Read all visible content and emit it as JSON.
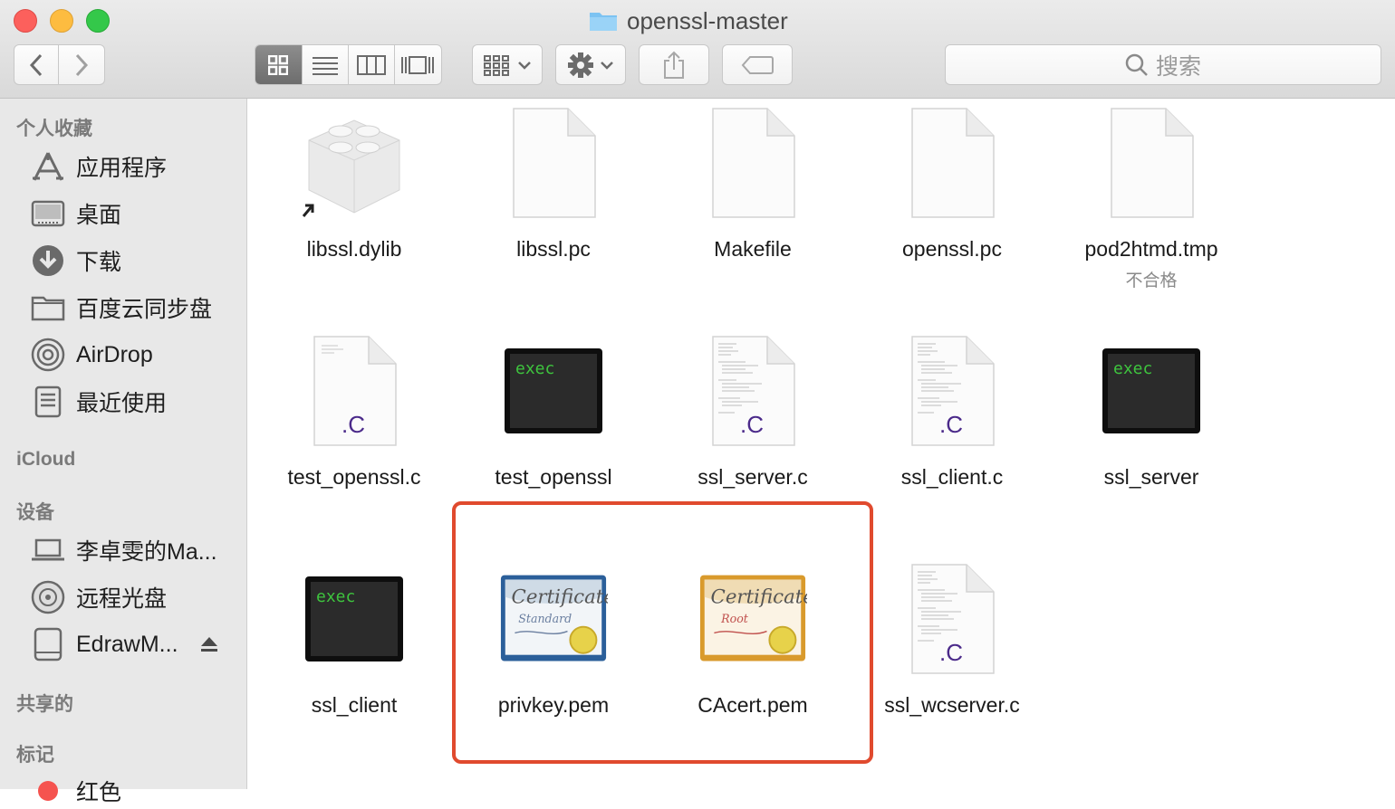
{
  "window": {
    "title": "openssl-master",
    "search_placeholder": "搜索"
  },
  "sidebar": {
    "sections": [
      {
        "heading": "个人收藏",
        "items": [
          {
            "label": "应用程序",
            "icon": "applications-icon"
          },
          {
            "label": "桌面",
            "icon": "desktop-icon"
          },
          {
            "label": "下载",
            "icon": "downloads-icon"
          },
          {
            "label": "百度云同步盘",
            "icon": "folder-icon"
          },
          {
            "label": "AirDrop",
            "icon": "airdrop-icon"
          },
          {
            "label": "最近使用",
            "icon": "recents-icon"
          }
        ]
      },
      {
        "heading": "iCloud",
        "items": []
      },
      {
        "heading": "设备",
        "items": [
          {
            "label": "李卓雯的Ma...",
            "icon": "laptop-icon"
          },
          {
            "label": "远程光盘",
            "icon": "remote-disc-icon"
          },
          {
            "label": "EdrawM...",
            "icon": "drive-icon"
          }
        ]
      },
      {
        "heading": "共享的",
        "items": []
      },
      {
        "heading": "标记",
        "items": [
          {
            "label": "红色",
            "icon": "red-tag-icon"
          }
        ]
      }
    ]
  },
  "files": [
    {
      "name": "libssl.dylib",
      "kind": "dylib"
    },
    {
      "name": "libssl.pc",
      "kind": "blank"
    },
    {
      "name": "Makefile",
      "kind": "blank"
    },
    {
      "name": "openssl.pc",
      "kind": "blank"
    },
    {
      "name": "pod2htmd.tmp",
      "kind": "blank",
      "subtitle": "不合格"
    },
    {
      "name": "test_openssl.c",
      "kind": "c-source",
      "ext": ".C"
    },
    {
      "name": "test_openssl",
      "kind": "exec",
      "label": "exec"
    },
    {
      "name": "ssl_server.c",
      "kind": "c-source",
      "ext": ".C"
    },
    {
      "name": "ssl_client.c",
      "kind": "c-source",
      "ext": ".C"
    },
    {
      "name": "ssl_server",
      "kind": "exec",
      "label": "exec"
    },
    {
      "name": "ssl_client",
      "kind": "exec",
      "label": "exec"
    },
    {
      "name": "privkey.pem",
      "kind": "certificate",
      "cert_title": "Certificate",
      "cert_sub": "Standard"
    },
    {
      "name": "CAcert.pem",
      "kind": "certificate",
      "cert_title": "Certificate",
      "cert_sub": "Root"
    },
    {
      "name": "ssl_wcserver.c",
      "kind": "c-source",
      "ext": ".C"
    }
  ],
  "colors": {
    "highlight_border": "#e04a2e",
    "c_extension": "#4b2a8a",
    "exec_text": "#3ec43e"
  }
}
